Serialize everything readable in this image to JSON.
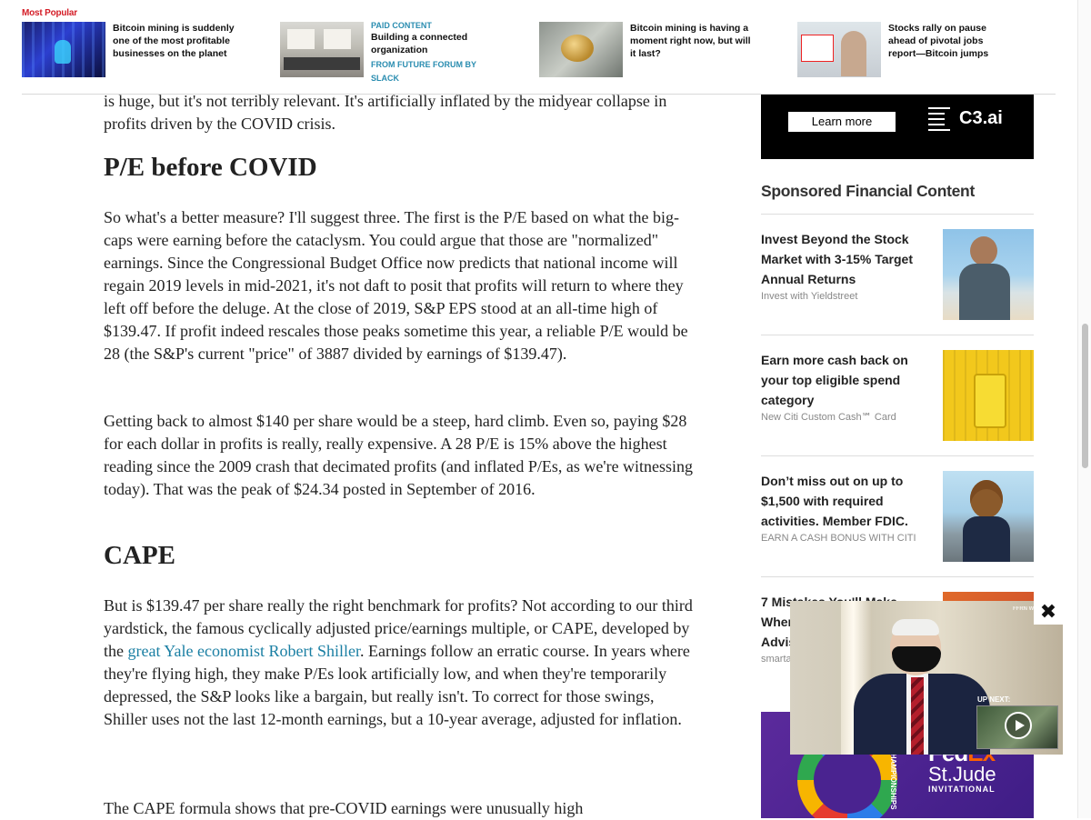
{
  "most_popular": {
    "label": "Most Popular",
    "items": [
      {
        "title": "Bitcoin mining is suddenly one of the most profitable businesses on the planet",
        "thumb_icon": "server-room-thumbnail"
      },
      {
        "paid_label": "PAID CONTENT",
        "title": "Building a connected organization",
        "sponsor": "FROM FUTURE FORUM BY SLACK",
        "thumb_icon": "office-thumbnail"
      },
      {
        "title": "Bitcoin mining is having a moment right now, but will it last?",
        "thumb_icon": "bitcoin-coin-thumbnail"
      },
      {
        "title": "Stocks rally on pause ahead of pivotal jobs report—Bitcoin jumps",
        "thumb_icon": "rally-thumbnail"
      }
    ]
  },
  "article": {
    "intro_para": "is huge, but it's not terribly relevant. It's artificially inflated by the midyear collapse in profits driven by the COVID crisis.",
    "heading1": "P/E before COVID",
    "para1": "So what's a better measure? I'll suggest three. The first is the P/E based on what the big-caps were earning before the cataclysm. You could argue that those are \"normalized\" earnings. Since the Congressional Budget Office now predicts that national income will regain 2019 levels in mid-2021, it's not daft to posit that profits will return to where they left off before the deluge. At the close of 2019, S&P EPS stood at an all-time high of $139.47. If profit indeed rescales those peaks sometime this year, a reliable P/E would be 28 (the S&P's current \"price\" of 3887 divided by earnings of $139.47).",
    "para2": "Getting back to almost $140 per share would be a steep, hard climb. Even so, paying $28 for each dollar in profits is really, really expensive. A 28 P/E is 15% above the highest reading since the 2009 crash that decimated profits (and inflated P/Es, as we're witnessing today). That was the peak of $24.34 posted in September of 2016.",
    "heading2": "CAPE",
    "para3_before_link": "But is $139.47 per share really the right benchmark for profits? Not according to our third yardstick, the famous cyclically adjusted price/earnings multiple, or CAPE, developed by the ",
    "para3_link": "great Yale economist Robert Shiller",
    "para3_after_link": ". Earnings follow an erratic course. In years where they're flying high, they make P/Es look artificially low, and when they're temporarily depressed, the S&P looks like a bargain, but really isn't. To correct for those swings, Shiller uses not the last 12-month earnings, but a 10-year average, adjusted for inflation.",
    "para4": "The CAPE formula shows that pre-COVID earnings were unusually high"
  },
  "rail": {
    "c3_ad": {
      "button_label": "Learn more",
      "brand": "C3.ai"
    },
    "sponsored_title": "Sponsored Financial Content",
    "sponsored_items": [
      {
        "headline": "Invest Beyond the Stock Market with 3-15% Target Annual Returns",
        "source": "Invest with Yieldstreet"
      },
      {
        "headline": "Earn more cash back on your top eligible spend category",
        "source": "New Citi Custom Cash℠ Card"
      },
      {
        "headline": "Don’t miss out on up to $1,500 with required activities. Member FDIC.",
        "source": "EARN A CASH BONUS WITH CITI"
      },
      {
        "headline": "7 Mistakes You'll Make When Hiring a Financial Advisor",
        "source": "smartasset"
      }
    ],
    "fedex_ad": {
      "ships": "CHAMPIONSHIPS",
      "fed": "Fed",
      "ex": "Ex",
      "stjude": "St.Jude",
      "invitational": "INVITATIONAL"
    }
  },
  "video": {
    "close_glyph": "✖",
    "up_next": "UP NEXT:",
    "flag_text": "FFRN WP"
  }
}
